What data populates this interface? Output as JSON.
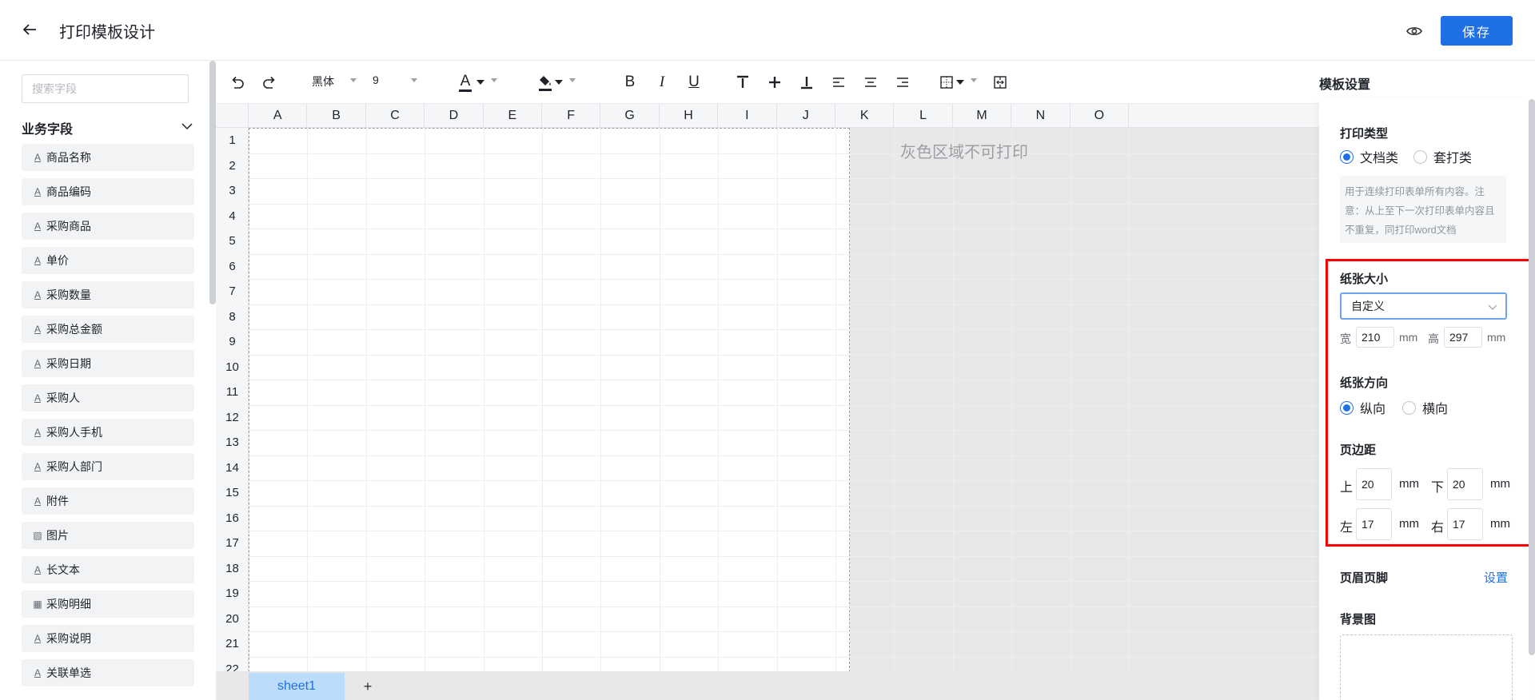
{
  "header": {
    "title": "打印模板设计",
    "save_label": "保存"
  },
  "left": {
    "search_placeholder": "搜索字段",
    "group_title": "业务字段",
    "fields": [
      {
        "label": "商品名称",
        "icon": "text-field-icon"
      },
      {
        "label": "商品编码",
        "icon": "text-field-icon"
      },
      {
        "label": "采购商品",
        "icon": "text-field-icon"
      },
      {
        "label": "单价",
        "icon": "text-field-icon"
      },
      {
        "label": "采购数量",
        "icon": "text-field-icon"
      },
      {
        "label": "采购总金额",
        "icon": "text-field-icon"
      },
      {
        "label": "采购日期",
        "icon": "text-field-icon"
      },
      {
        "label": "采购人",
        "icon": "text-field-icon"
      },
      {
        "label": "采购人手机",
        "icon": "text-field-icon"
      },
      {
        "label": "采购人部门",
        "icon": "text-field-icon"
      },
      {
        "label": "附件",
        "icon": "text-field-icon"
      },
      {
        "label": "图片",
        "icon": "image-icon"
      },
      {
        "label": "长文本",
        "icon": "text-field-icon"
      },
      {
        "label": "采购明细",
        "icon": "table-icon"
      },
      {
        "label": "采购说明",
        "icon": "text-field-icon"
      },
      {
        "label": "关联单选",
        "icon": "text-field-icon"
      }
    ]
  },
  "toolbar": {
    "font_family": "黑体",
    "font_size": "9",
    "bold": "B",
    "italic": "I",
    "underline": "U",
    "font_color_glyph": "A"
  },
  "grid": {
    "columns": [
      "A",
      "B",
      "C",
      "D",
      "E",
      "F",
      "G",
      "H",
      "I",
      "J",
      "K",
      "L",
      "M",
      "N",
      "O"
    ],
    "rows": [
      "1",
      "2",
      "3",
      "4",
      "5",
      "6",
      "7",
      "8",
      "9",
      "10",
      "11",
      "12",
      "13",
      "14",
      "15",
      "16",
      "17",
      "18",
      "19",
      "20",
      "21",
      "22"
    ],
    "nonprint_text": "灰色区域不可打印",
    "sheet_tab": "sheet1",
    "add_sheet": "+"
  },
  "settings": {
    "panel_title": "模板设置",
    "print_type": {
      "title": "打印类型",
      "options": [
        "文档类",
        "套打类"
      ],
      "selected": "文档类",
      "description": "用于连续打印表单所有内容。注意：从上至下一次打印表单内容且不重复，同打印word文档"
    },
    "paper_size": {
      "title": "纸张大小",
      "value": "自定义",
      "width_label": "宽",
      "width": "210",
      "height_label": "高",
      "height": "297",
      "unit": "mm"
    },
    "orientation": {
      "title": "纸张方向",
      "options": [
        "纵向",
        "横向"
      ],
      "selected": "纵向"
    },
    "margins": {
      "title": "页边距",
      "top_label": "上",
      "top": "20",
      "bottom_label": "下",
      "bottom": "20",
      "left_label": "左",
      "left": "17",
      "right_label": "右",
      "right": "17",
      "unit": "mm"
    },
    "header_footer": {
      "title": "页眉页脚",
      "link": "设置"
    },
    "background": {
      "title": "背景图"
    }
  },
  "colors": {
    "primary": "#1f6fe5",
    "highlight": "#ff0000",
    "nonprint_bg": "#e8e8e8"
  }
}
